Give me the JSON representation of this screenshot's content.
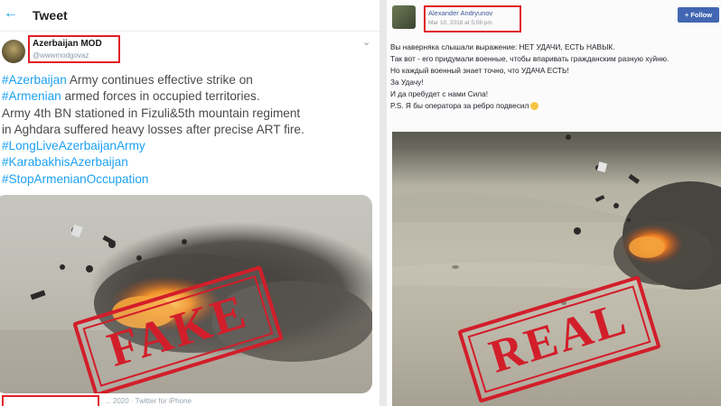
{
  "left": {
    "header_title": "Tweet",
    "account_name": "Azerbaijan MOD",
    "account_handle": "@wwwmodgovaz",
    "tweet_lines": [
      {
        "tag": "#Azerbaijan",
        "text": " Army continues effective strike on"
      },
      {
        "tag": "#Armenian",
        "text": " armed forces in occupied territories."
      },
      {
        "tag": "",
        "text": "Army 4th BN stationed in Fizuli&5th mountain regiment"
      },
      {
        "tag": "",
        "text": "in Aghdara suffered heavy losses after precise ART fire."
      },
      {
        "tag": "#LongLiveAzerbaijanArmy",
        "text": ""
      },
      {
        "tag": "#KarabakhisAzerbaijan",
        "text": ""
      },
      {
        "tag": "#StopArmenianOccupation",
        "text": ""
      }
    ],
    "timestamp": "",
    "footer_text": "... 2020 · Twitter for iPhone",
    "stamp_label": "FAKE"
  },
  "right": {
    "author": "Alexander Andryunov",
    "date": "Mar 10, 2018 at 5:08 pm",
    "follow_label": "+ Follow",
    "post_lines": [
      "Вы наверняка слышали выражение: НЕТ УДАЧИ, ЕСТЬ НАВЫК.",
      "Так вот - его придумали военные, чтобы впаривать гражданским разную хуйню.",
      "Но каждый военный знает точно, что УДАЧА ЕСТЬ!",
      "За Удачу!",
      "И да пребудет с нами Сила!",
      "P.S. Я бы оператора за ребро подвесил"
    ],
    "stamp_label": "REAL"
  },
  "colors": {
    "stamp_red": "#d21e2a",
    "link_blue": "#1da1f2",
    "highlight_box": "#e11d26"
  }
}
